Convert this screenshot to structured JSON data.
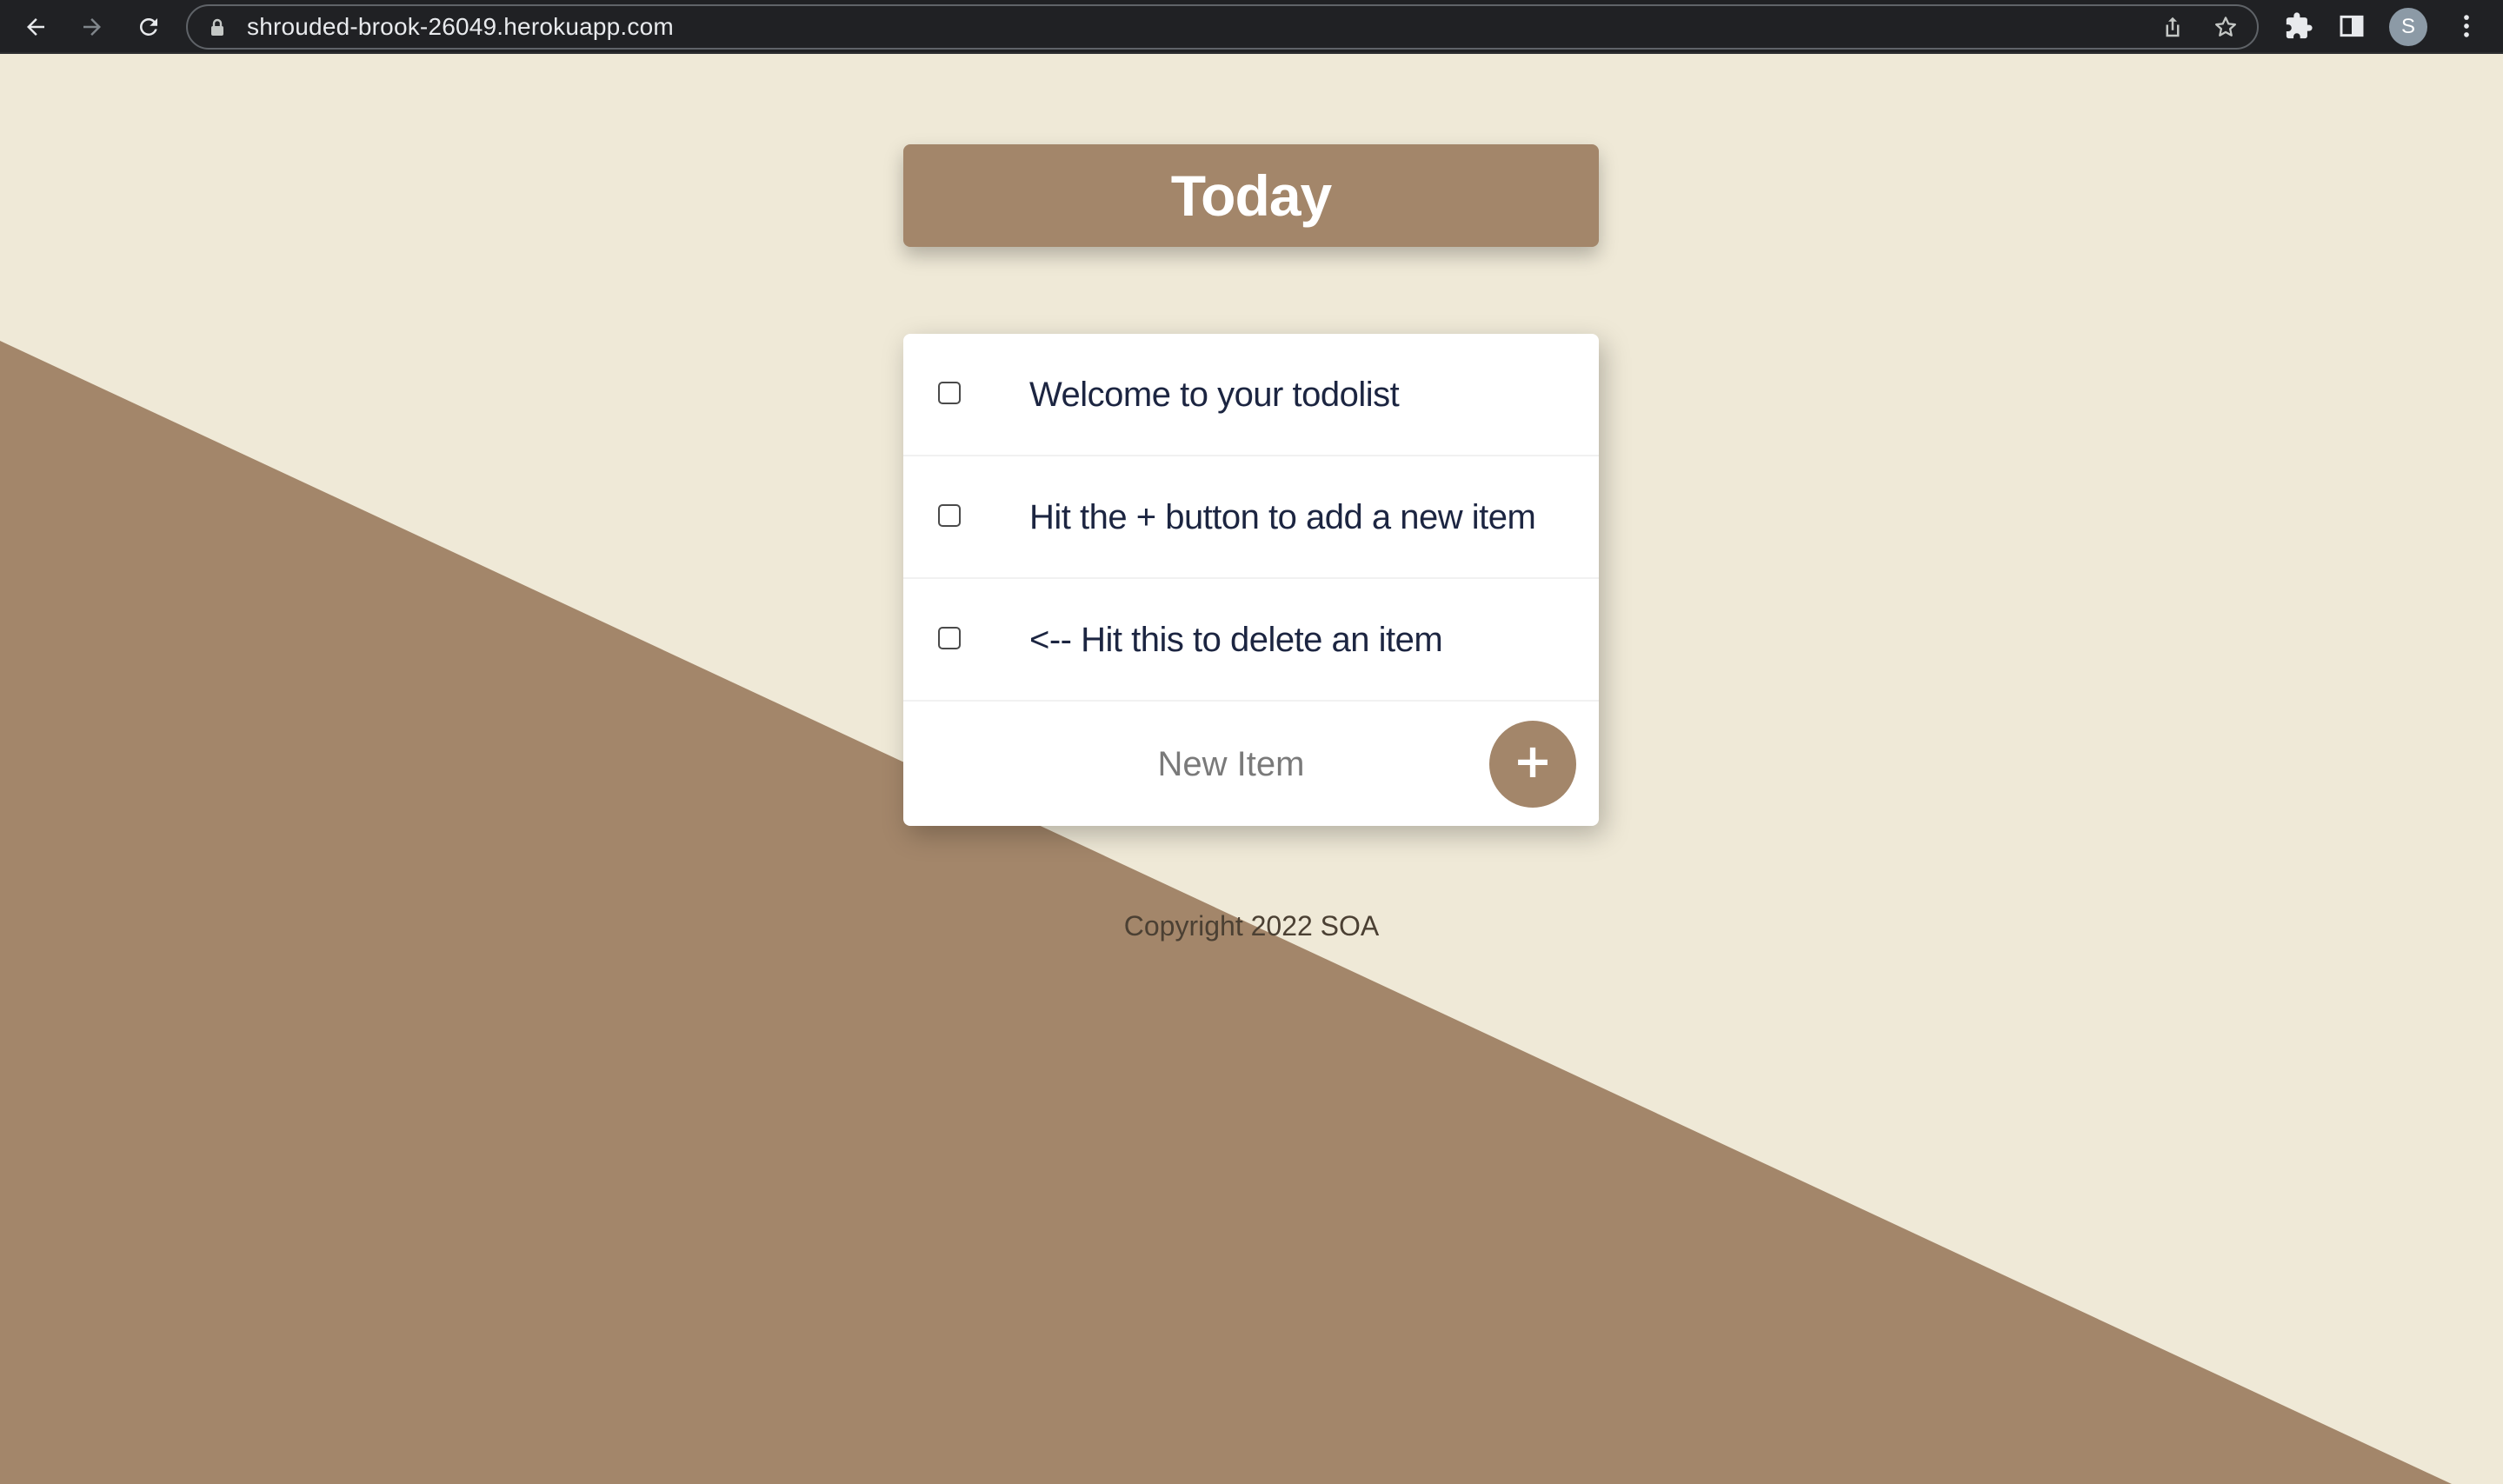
{
  "browser": {
    "url": "shrouded-brook-26049.herokuapp.com",
    "profile_initial": "S"
  },
  "colors": {
    "background": "#EFE9D7",
    "accent": "#A3866A",
    "card": "#FFFFFF",
    "item_text": "#1C2541"
  },
  "page": {
    "title": "Today",
    "items": [
      {
        "label": "Welcome to your todolist",
        "checked": false
      },
      {
        "label": "Hit the + button to add a new item",
        "checked": false
      },
      {
        "label": "<-- Hit this to delete an item",
        "checked": false
      }
    ],
    "new_item_placeholder": "New Item",
    "add_button_label": "+",
    "footer": "Copyright 2022 SOA"
  }
}
